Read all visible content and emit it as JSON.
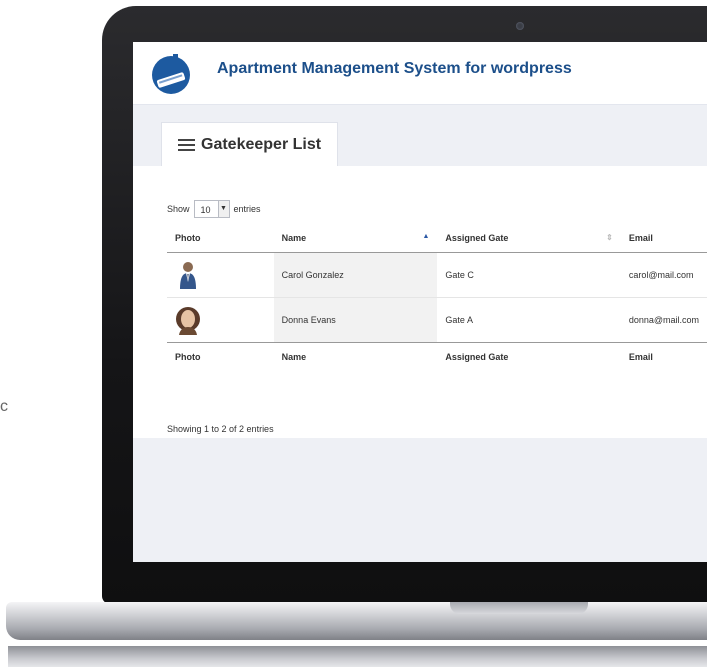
{
  "window_hint": "c",
  "app": {
    "title": "Apartment Management System for wordpress",
    "logo_icon": "building-logo-icon",
    "accent_color": "#1c4f8a"
  },
  "tab": {
    "label": "Gatekeeper List",
    "icon": "list-icon"
  },
  "length_control": {
    "show_label": "Show",
    "value": "10",
    "entries_label": "entries"
  },
  "table": {
    "columns": [
      "Photo",
      "Name",
      "Assigned Gate",
      "Email"
    ],
    "sorted_column": "Name",
    "rows": [
      {
        "photo": "avatar-male-icon",
        "name": "Carol Gonzalez",
        "gate": "Gate C",
        "email": "carol@mail.com"
      },
      {
        "photo": "avatar-female-icon",
        "name": "Donna Evans",
        "gate": "Gate A",
        "email": "donna@mail.com"
      }
    ],
    "info": "Showing 1 to 2 of 2 entries"
  }
}
